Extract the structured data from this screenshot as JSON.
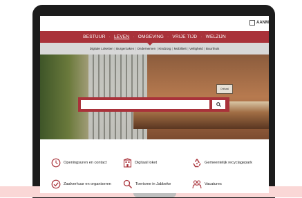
{
  "topbar": {
    "aan_label": "AANM"
  },
  "main_nav": {
    "items": [
      "BESTUUR",
      "LEVEN",
      "OMGEVING",
      "VRIJE TIJD",
      "WELZIJN"
    ],
    "active": "LEVEN"
  },
  "sub_nav": {
    "items": [
      "Digitale Loketten",
      "Burgerzaken",
      "Ondernemen",
      "Kindzorg",
      "Mobiliteit",
      "Veiligheid",
      "Buurthuis"
    ]
  },
  "hero": {
    "sign_text": "Onthaal"
  },
  "search": {
    "placeholder": ""
  },
  "quick_links": [
    {
      "label": "Openingsuren en contact",
      "icon": "clock-icon"
    },
    {
      "label": "Digitaal loket",
      "icon": "building-icon"
    },
    {
      "label": "Gemeentelijk recyclagepark",
      "icon": "recycle-icon"
    },
    {
      "label": "Zaalverhuur en organiseren",
      "icon": "checkmark-icon"
    },
    {
      "label": "Toerisme in Jabbeke",
      "icon": "magnifier-icon"
    },
    {
      "label": "Vacatures",
      "icon": "people-icon"
    }
  ],
  "colors": {
    "brand": "#a9323a",
    "subnav_bg": "#d8d8d8",
    "tray": "#fad7d6"
  }
}
